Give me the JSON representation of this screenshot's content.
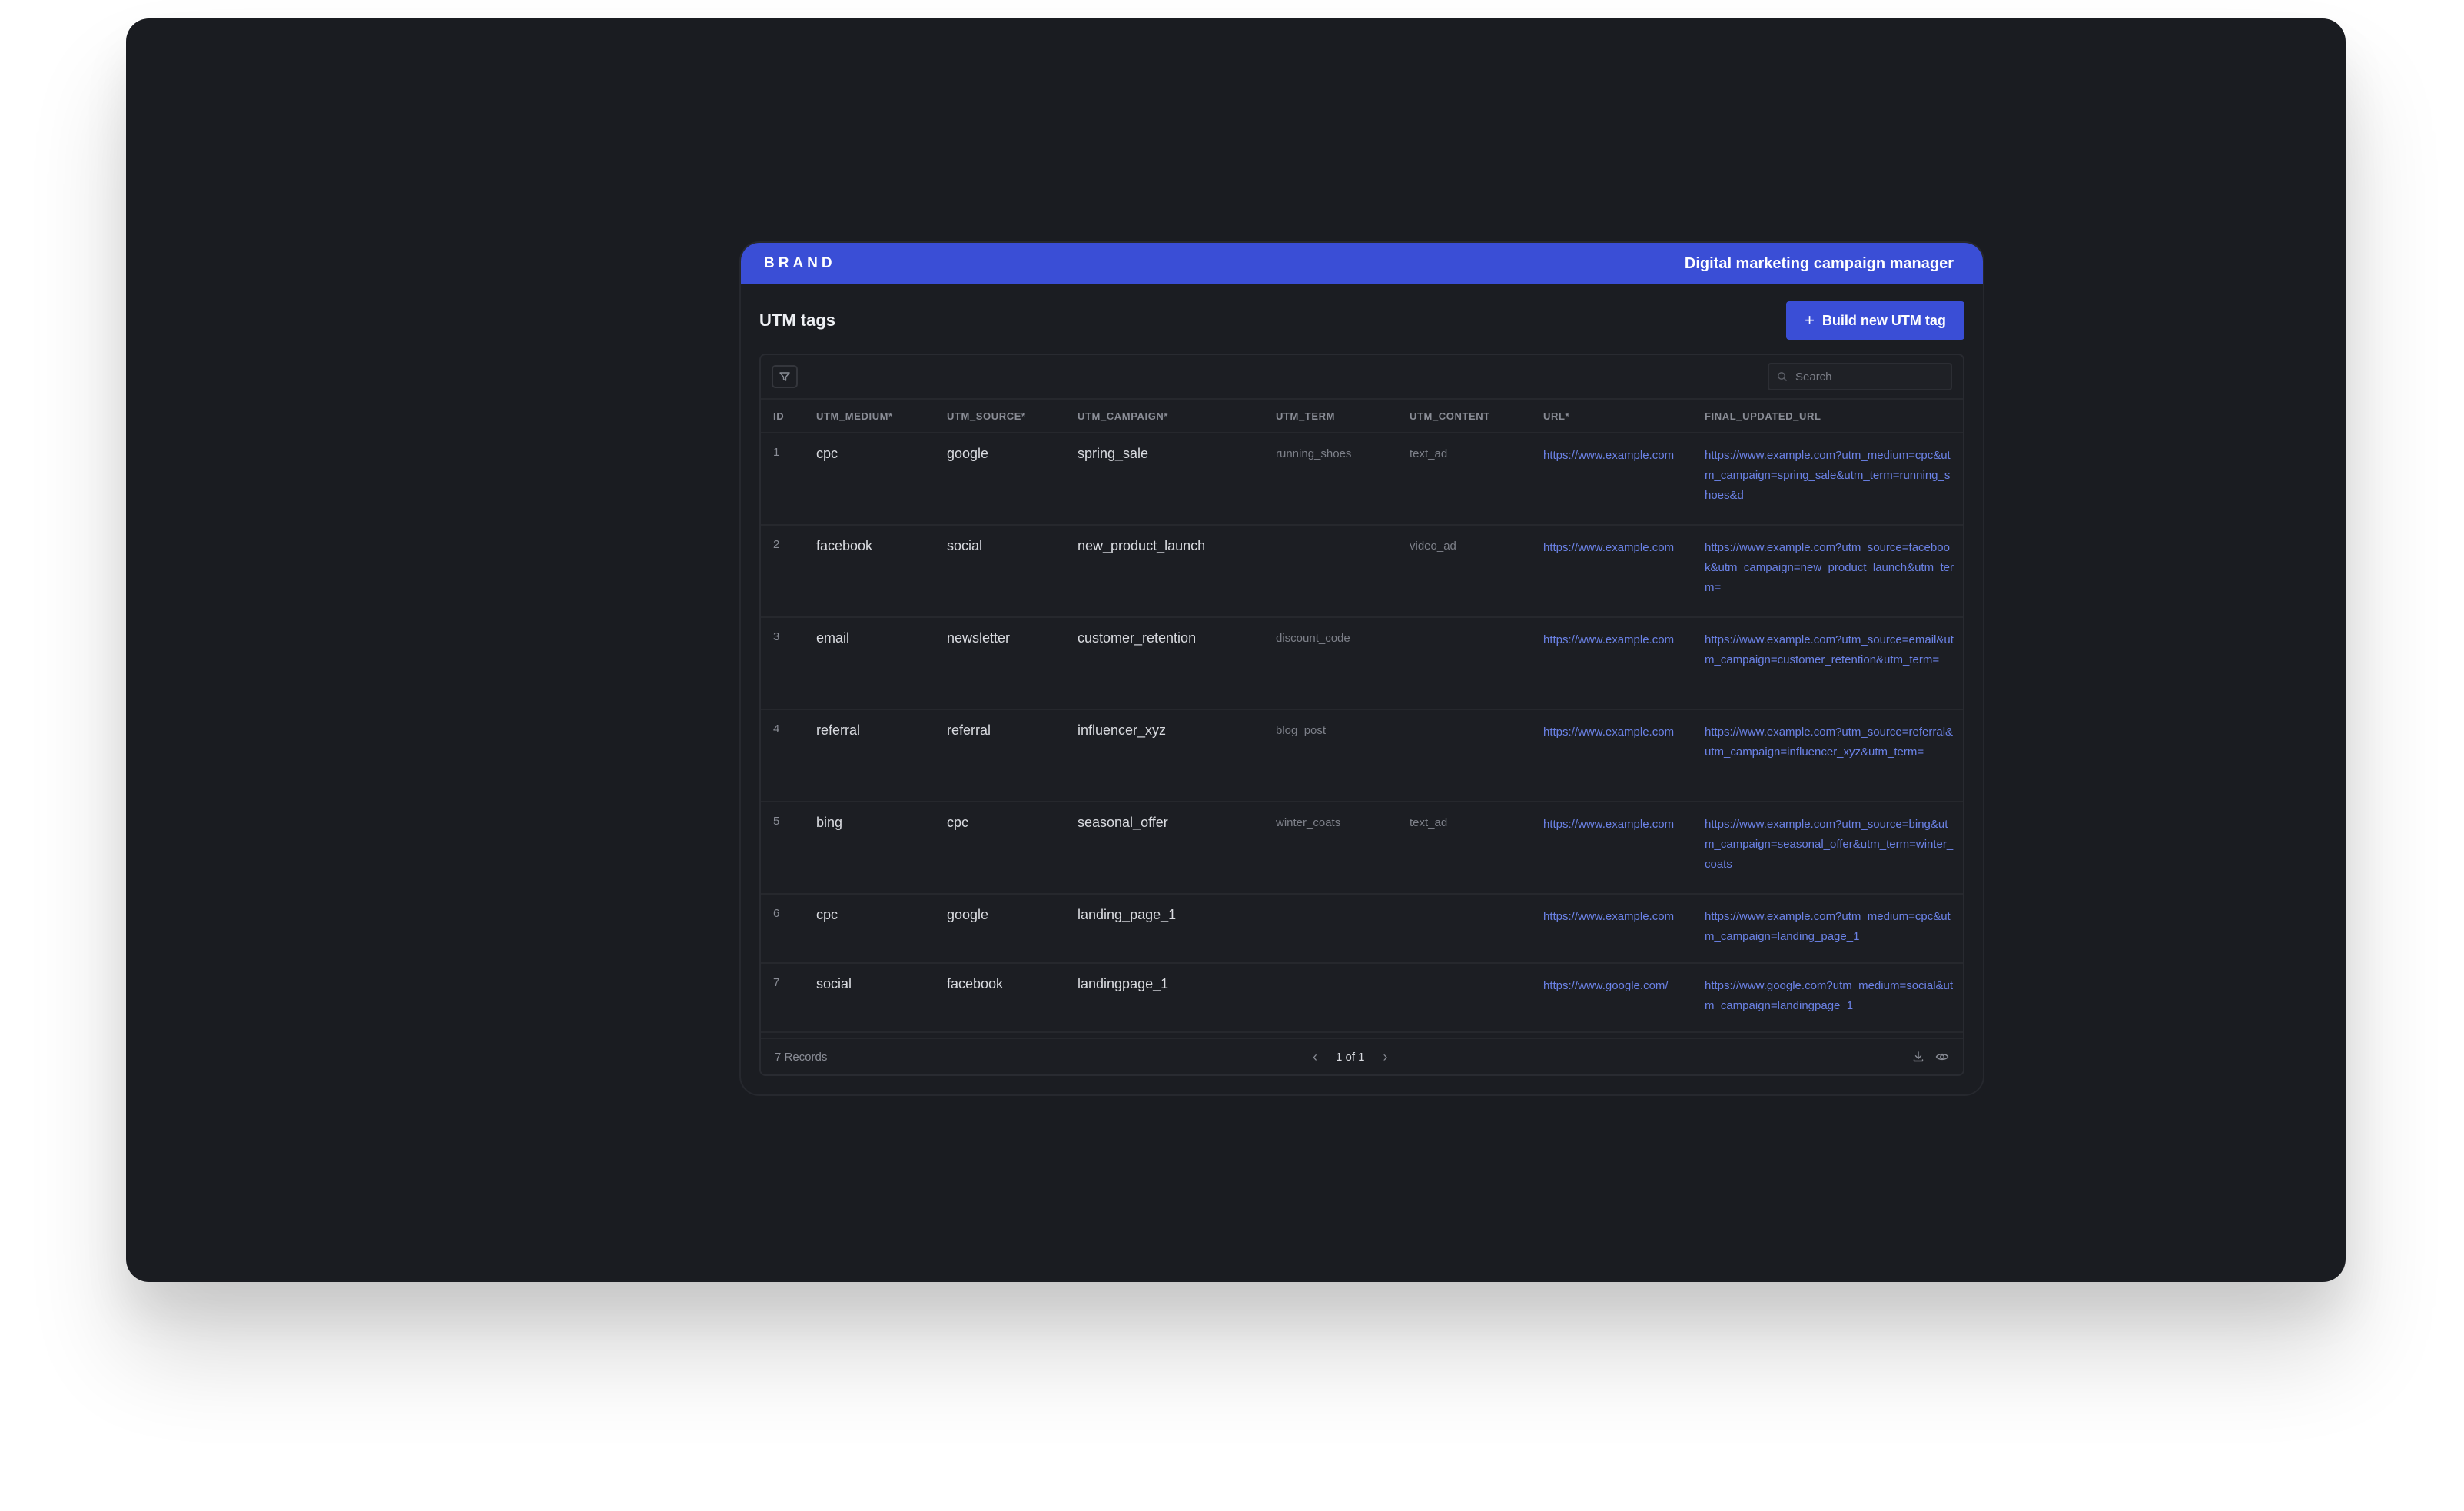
{
  "header": {
    "brand": "BRAND",
    "app_name": "Digital marketing campaign manager"
  },
  "page": {
    "title": "UTM tags",
    "build_button": "Build new UTM tag"
  },
  "toolbar": {
    "search_placeholder": "Search"
  },
  "table": {
    "columns": [
      "ID",
      "UTM_MEDIUM*",
      "UTM_SOURCE*",
      "UTM_CAMPAIGN*",
      "UTM_TERM",
      "UTM_CONTENT",
      "URL*",
      "FINAL_UPDATED_URL"
    ],
    "rows": [
      {
        "id": "1",
        "medium": "cpc",
        "source": "google",
        "campaign": "spring_sale",
        "term": "running_shoes",
        "content": "text_ad",
        "url": "https://www.example.com",
        "final_url": "https://www.example.com?utm_medium=cpc&utm_campaign=spring_sale&utm_term=running_shoes&d"
      },
      {
        "id": "2",
        "medium": "facebook",
        "source": "social",
        "campaign": "new_product_launch",
        "term": "",
        "content": "video_ad",
        "url": "https://www.example.com",
        "final_url": "https://www.example.com?utm_source=facebook&utm_campaign=new_product_launch&utm_term="
      },
      {
        "id": "3",
        "medium": "email",
        "source": "newsletter",
        "campaign": "customer_retention",
        "term": "discount_code",
        "content": "",
        "url": "https://www.example.com",
        "final_url": "https://www.example.com?utm_source=email&utm_campaign=customer_retention&utm_term="
      },
      {
        "id": "4",
        "medium": "referral",
        "source": "referral",
        "campaign": "influencer_xyz",
        "term": "blog_post",
        "content": "",
        "url": "https://www.example.com",
        "final_url": "https://www.example.com?utm_source=referral&utm_campaign=influencer_xyz&utm_term="
      },
      {
        "id": "5",
        "medium": "bing",
        "source": "cpc",
        "campaign": "seasonal_offer",
        "term": "winter_coats",
        "content": "text_ad",
        "url": "https://www.example.com",
        "final_url": "https://www.example.com?utm_source=bing&utm_campaign=seasonal_offer&utm_term=winter_coats"
      },
      {
        "id": "6",
        "medium": "cpc",
        "source": "google",
        "campaign": "landing_page_1",
        "term": "",
        "content": "",
        "url": "https://www.example.com",
        "final_url": "https://www.example.com?utm_medium=cpc&utm_campaign=landing_page_1"
      },
      {
        "id": "7",
        "medium": "social",
        "source": "facebook",
        "campaign": "landingpage_1",
        "term": "",
        "content": "",
        "url": "https://www.google.com/",
        "final_url": "https://www.google.com?utm_medium=social&utm_campaign=landingpage_1"
      }
    ]
  },
  "footer": {
    "records": "7 Records",
    "pagination": "1 of 1"
  },
  "icons": {
    "filter": "filter-icon",
    "search": "search-icon",
    "prev": "chevron-left-icon",
    "next": "chevron-right-icon",
    "download": "download-icon",
    "view": "eye-icon"
  },
  "colors": {
    "brand_blue": "#3a4ed6",
    "link": "#6b82e6",
    "background": "#1a1c21"
  }
}
